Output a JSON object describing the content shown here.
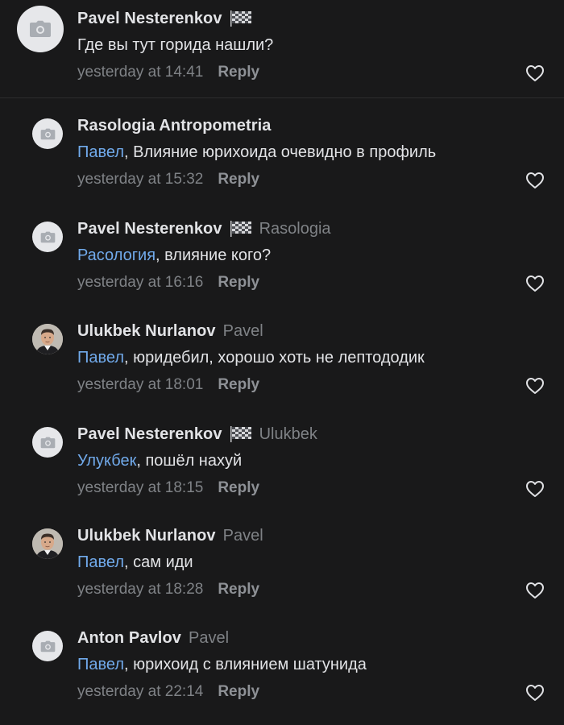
{
  "comments": [
    {
      "author": "Pavel Nesterenkov",
      "has_flag": true,
      "reply_to": "",
      "mention": "",
      "text": "Где вы тут горида нашли?",
      "time": "yesterday at 14:41",
      "reply_label": "Reply",
      "avatar": "camera-placeholder"
    },
    {
      "author": "Rasologia Antropometria",
      "has_flag": false,
      "reply_to": "",
      "mention": "Павел",
      "text": ", Влияние юрихоида очевидно в профиль",
      "time": "yesterday at 15:32",
      "reply_label": "Reply",
      "avatar": "camera-placeholder"
    },
    {
      "author": "Pavel Nesterenkov",
      "has_flag": true,
      "reply_to": "Rasologia",
      "mention": "Расология",
      "text": ", влияние кого?",
      "time": "yesterday at 16:16",
      "reply_label": "Reply",
      "avatar": "camera-placeholder"
    },
    {
      "author": "Ulukbek Nurlanov",
      "has_flag": false,
      "reply_to": "Pavel",
      "mention": "Павел",
      "text": ", юридебил, хорошо хоть не лептододик",
      "time": "yesterday at 18:01",
      "reply_label": "Reply",
      "avatar": "user-photo"
    },
    {
      "author": "Pavel Nesterenkov",
      "has_flag": true,
      "reply_to": "Ulukbek",
      "mention": "Улукбек",
      "text": ", пошёл нахуй",
      "time": "yesterday at 18:15",
      "reply_label": "Reply",
      "avatar": "camera-placeholder"
    },
    {
      "author": "Ulukbek Nurlanov",
      "has_flag": false,
      "reply_to": "Pavel",
      "mention": "Павел",
      "text": ", сам иди",
      "time": "yesterday at 18:28",
      "reply_label": "Reply",
      "avatar": "user-photo"
    },
    {
      "author": "Anton Pavlov",
      "has_flag": false,
      "reply_to": "Pavel",
      "mention": "Павел",
      "text": ", юрихоид с влиянием шатунида",
      "time": "yesterday at 22:14",
      "reply_label": "Reply",
      "avatar": "camera-placeholder"
    }
  ],
  "colors": {
    "background": "#19191a",
    "text": "#e2e3e6",
    "secondary": "#7f8286",
    "mention": "#71aaeb"
  },
  "icons": {
    "flag": "checkered-flag-icon",
    "like": "heart-outline-icon",
    "placeholder": "camera-icon"
  }
}
